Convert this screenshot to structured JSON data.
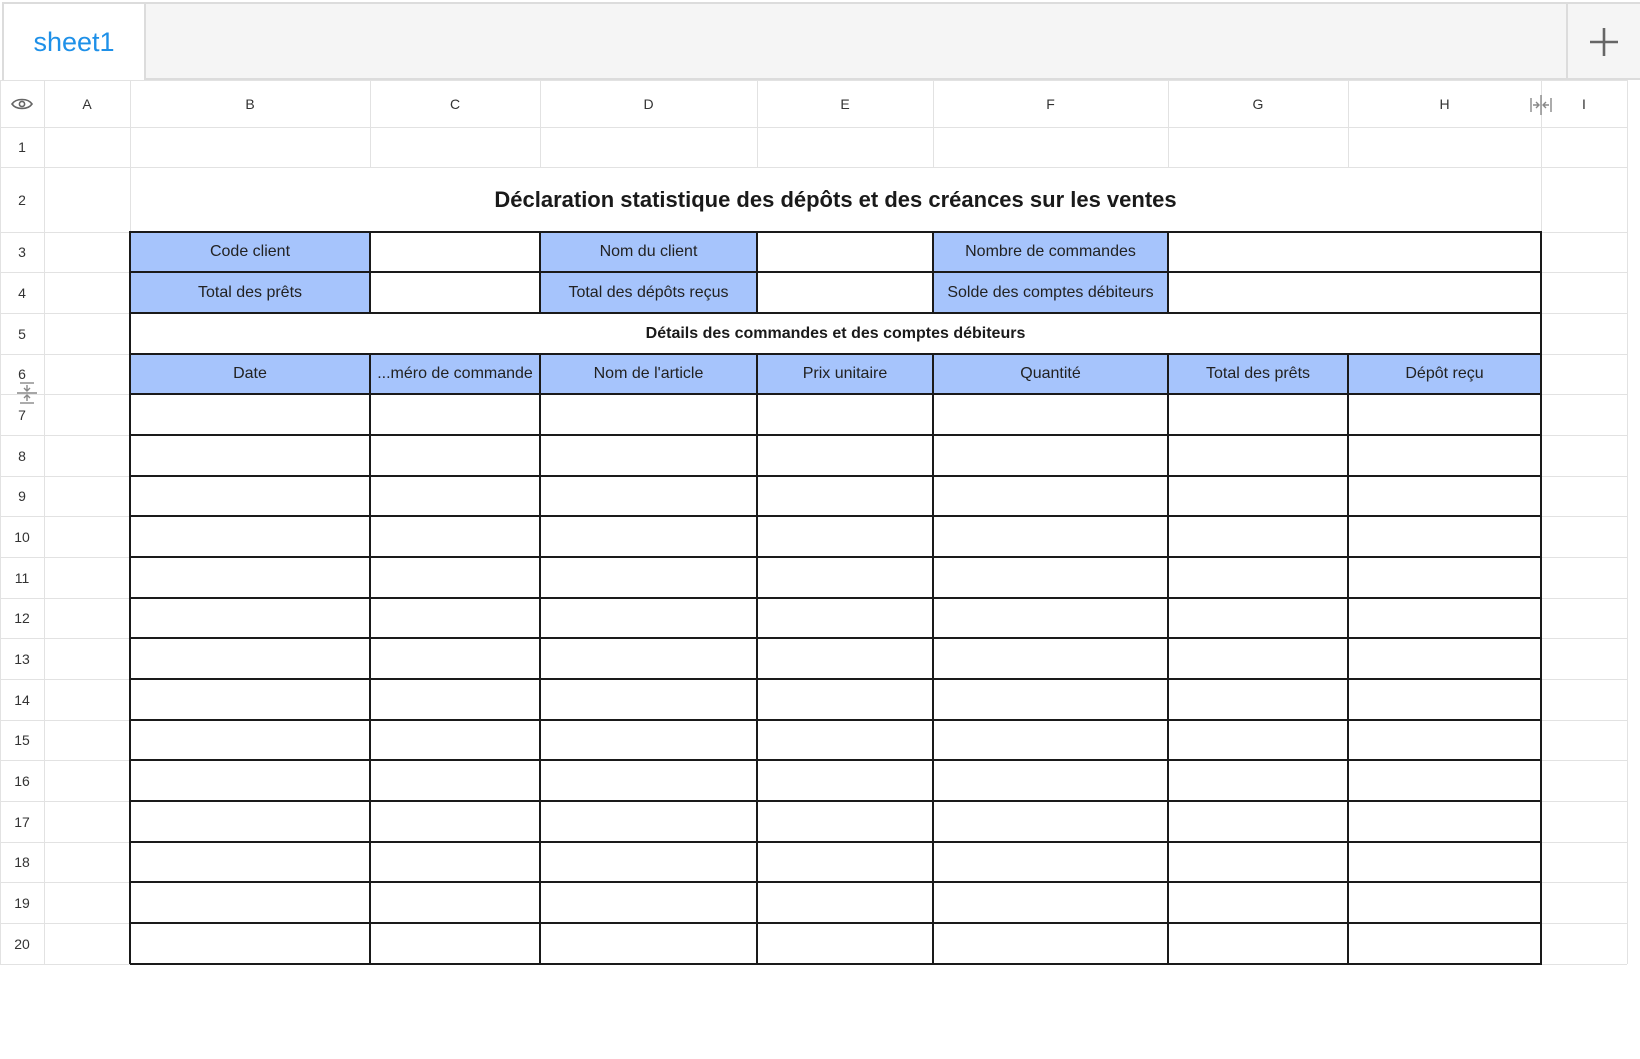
{
  "tabs": [
    {
      "label": "sheet1",
      "active": true
    }
  ],
  "add_sheet_icon": "plus-icon",
  "corner_icon": "eye-icon",
  "columns": [
    "A",
    "B",
    "C",
    "D",
    "E",
    "F",
    "G",
    "H",
    "I"
  ],
  "rows": [
    "1",
    "2",
    "3",
    "4",
    "5",
    "6",
    "7",
    "8",
    "9",
    "10",
    "11",
    "12",
    "13",
    "14",
    "15",
    "16",
    "17",
    "18",
    "19",
    "20"
  ],
  "sheet": {
    "title": "Déclaration statistique des dépôts et des créances sur les ventes",
    "info_labels": {
      "customer_code": "Code client",
      "customer_name": "Nom du client",
      "order_count": "Nombre de commandes",
      "total_loans": "Total des prêts",
      "total_deposits": "Total des dépôts reçus",
      "receivables_balance": "Solde des comptes débiteurs"
    },
    "section_title": "Détails des commandes et des comptes débiteurs",
    "table_headers": [
      "Date",
      "...méro de commande",
      "Nom de l'article",
      "Prix unitaire",
      "Quantité",
      "Total des prêts",
      "Dépôt reçu"
    ]
  },
  "colors": {
    "tab_active_text": "#1e90e8",
    "label_fill": "#a6c4fc",
    "border": "#1a1a1a",
    "gridline": "#e2e2e2"
  }
}
